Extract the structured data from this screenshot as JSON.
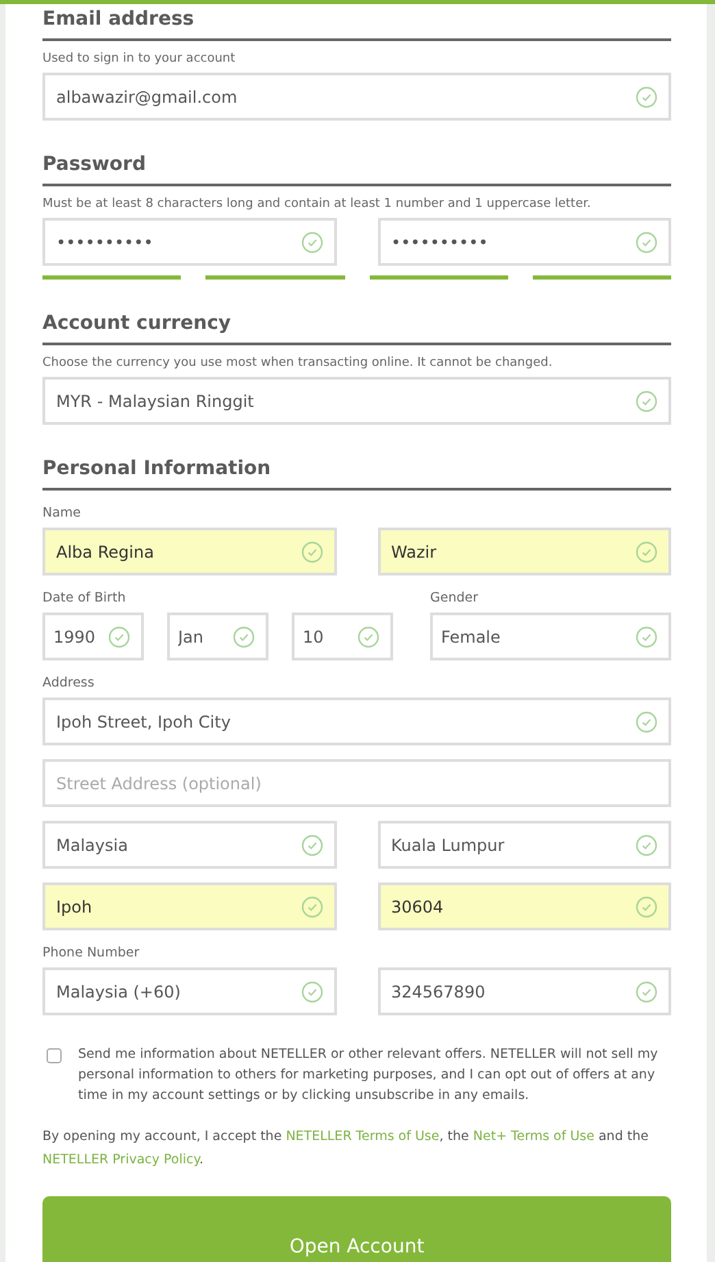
{
  "sections": [
    {
      "title": "Email address",
      "hint": "Used to sign in to your account",
      "rows": [
        {
          "kind": "single",
          "fields": [
            {
              "value": "albawazir@gmail.com",
              "valid": true,
              "autofilled": false
            }
          ]
        }
      ]
    },
    {
      "title": "Password",
      "hint": "Must be at least 8 characters long and contain at least 1 number and 1 uppercase letter.",
      "rows": [
        {
          "kind": "pair",
          "fields": [
            {
              "value": "••••••••••",
              "valid": true,
              "autofilled": false
            },
            {
              "value": "••••••••••",
              "valid": true,
              "autofilled": false
            }
          ]
        },
        {
          "kind": "meter"
        }
      ]
    },
    {
      "title": "Account currency",
      "hint": "Choose the currency you use most when transacting online. It cannot be changed.",
      "rows": [
        {
          "kind": "single",
          "fields": [
            {
              "value": "MYR - Malaysian Ringgit",
              "valid": true,
              "autofilled": false
            }
          ]
        }
      ]
    },
    {
      "title": "Personal Information",
      "rows": [
        {
          "kind": "label",
          "texts": [
            "Name"
          ]
        },
        {
          "kind": "pair",
          "fields": [
            {
              "value": "Alba Regina",
              "valid": true,
              "autofilled": true
            },
            {
              "value": "Wazir",
              "valid": true,
              "autofilled": true
            }
          ]
        },
        {
          "kind": "label_pair",
          "texts": [
            "Date of Birth",
            "Gender"
          ]
        },
        {
          "kind": "date",
          "fields": [
            {
              "value": "1990",
              "valid": true,
              "autofilled": false
            },
            {
              "value": "Jan",
              "valid": true,
              "autofilled": false
            },
            {
              "value": "10",
              "valid": true,
              "autofilled": false
            },
            {
              "value": "Female",
              "valid": true,
              "autofilled": false
            }
          ]
        },
        {
          "kind": "label",
          "texts": [
            "Address"
          ]
        },
        {
          "kind": "single",
          "fields": [
            {
              "value": "Ipoh Street, Ipoh City",
              "valid": true,
              "autofilled": false
            }
          ]
        },
        {
          "kind": "single",
          "fields": [
            {
              "placeholder": "Street Address (optional)",
              "valid": false,
              "autofilled": false
            }
          ]
        },
        {
          "kind": "pair",
          "fields": [
            {
              "value": "Malaysia",
              "valid": true,
              "autofilled": false
            },
            {
              "value": "Kuala Lumpur",
              "valid": true,
              "autofilled": false
            }
          ]
        },
        {
          "kind": "pair",
          "fields": [
            {
              "value": "Ipoh",
              "valid": true,
              "autofilled": true
            },
            {
              "value": "30604",
              "valid": true,
              "autofilled": true
            }
          ]
        },
        {
          "kind": "label",
          "texts": [
            "Phone Number"
          ]
        },
        {
          "kind": "pair",
          "fields": [
            {
              "value": "Malaysia (+60)",
              "valid": true,
              "autofilled": false
            },
            {
              "value": "324567890",
              "valid": true,
              "autofilled": false
            }
          ]
        }
      ]
    }
  ],
  "consent": {
    "checked": false,
    "text": "Send me information about NETELLER or other relevant offers. NETELLER will not sell my personal information to others for marketing purposes, and I can opt out of offers at any time in my account settings or by clicking unsubscribe in any emails."
  },
  "legal": [
    {
      "text": "By opening my account, I accept the ",
      "kind": "text"
    },
    {
      "text": "NETELLER Terms of Use",
      "kind": "link"
    },
    {
      "text": ", the ",
      "kind": "text"
    },
    {
      "text": "Net+ Terms of Use",
      "kind": "link"
    },
    {
      "text": " and the ",
      "kind": "text"
    },
    {
      "text": "NETELLER Privacy Policy",
      "kind": "link"
    },
    {
      "text": ".",
      "kind": "text"
    }
  ],
  "submit": "Open Account"
}
